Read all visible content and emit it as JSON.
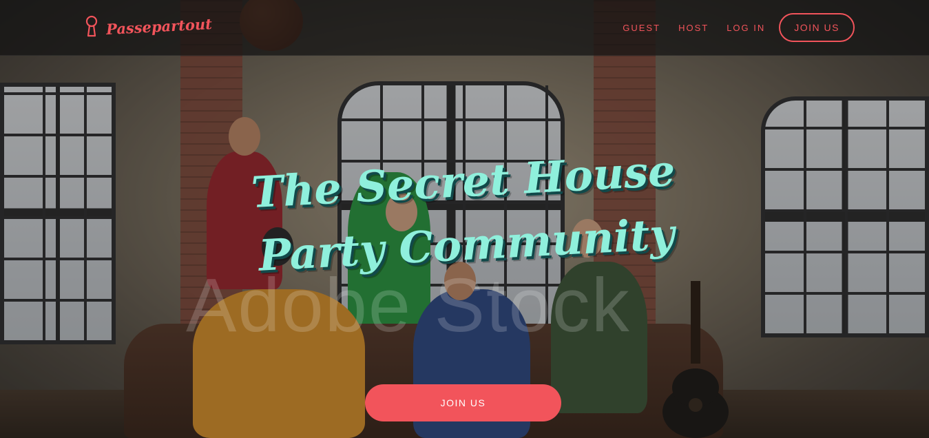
{
  "brand": {
    "name": "Passepartout",
    "icon": "keyhole-icon",
    "color": "#f2545b"
  },
  "nav": {
    "links": [
      "GUEST",
      "HOST",
      "LOG IN"
    ],
    "join_label": "JOIN US"
  },
  "hero": {
    "title_line1": "The Secret House",
    "title_line2": "Party Community",
    "cta_label": "JOIN US",
    "title_color": "#8ff0dc",
    "cta_color": "#f2545b"
  },
  "background": {
    "watermark": "Adobe Stock"
  }
}
